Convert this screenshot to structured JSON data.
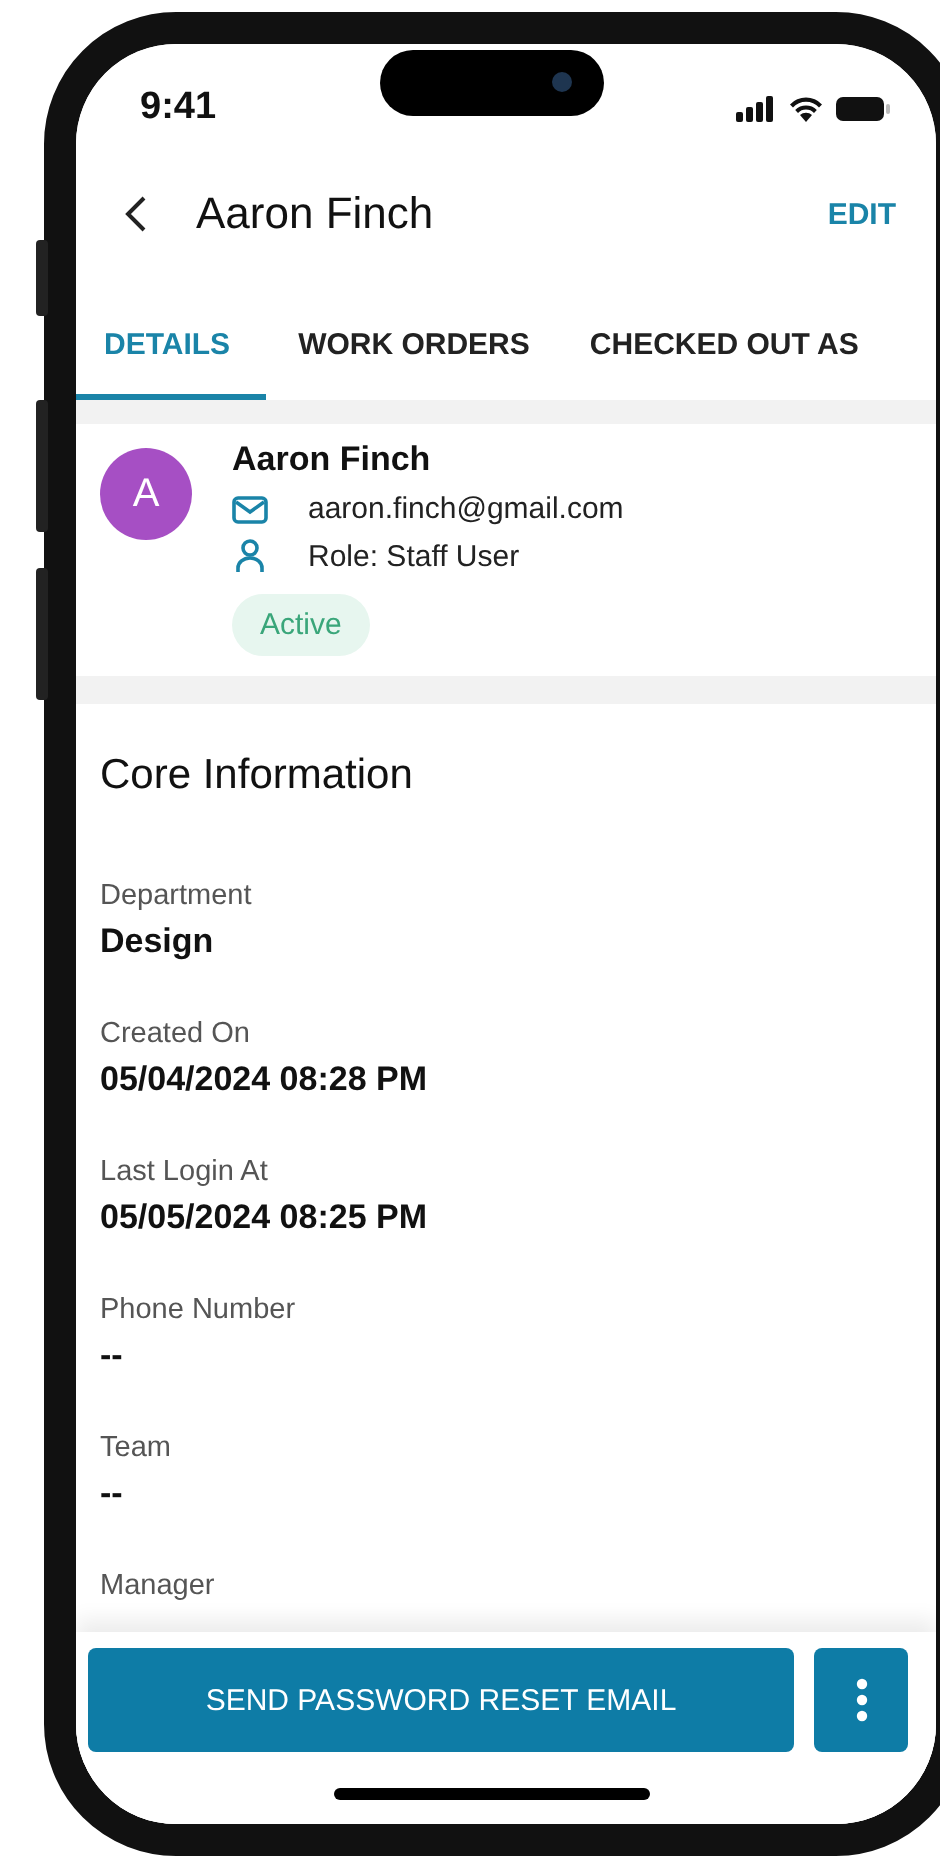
{
  "status_bar": {
    "time": "9:41"
  },
  "header": {
    "title": "Aaron Finch",
    "action": "EDIT"
  },
  "tabs": [
    {
      "label": "DETAILS",
      "selected": true
    },
    {
      "label": "WORK ORDERS",
      "selected": false
    },
    {
      "label": "CHECKED OUT AS",
      "selected": false
    }
  ],
  "profile": {
    "initial": "A",
    "name": "Aaron Finch",
    "email": "aaron.finch@gmail.com",
    "role": "Role: Staff User",
    "status": "Active"
  },
  "core_information": {
    "title": "Core Information",
    "fields": [
      {
        "label": "Department",
        "value": "Design"
      },
      {
        "label": "Created On",
        "value": "05/04/2024 08:28 PM"
      },
      {
        "label": "Last Login At",
        "value": "05/05/2024 08:25 PM"
      },
      {
        "label": "Phone Number",
        "value": "--"
      },
      {
        "label": "Team",
        "value": "--"
      },
      {
        "label": "Manager"
      }
    ]
  },
  "bottom_bar": {
    "primary_button": "SEND PASSWORD RESET EMAIL"
  }
}
